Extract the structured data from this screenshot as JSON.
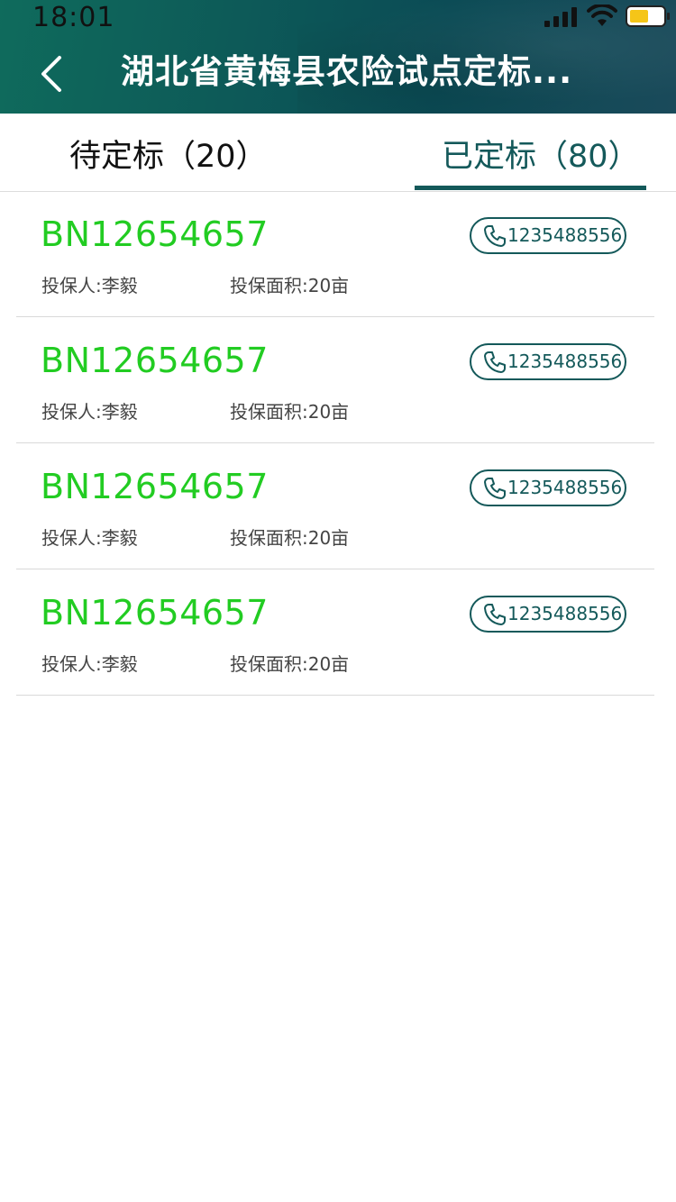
{
  "status_bar": {
    "time": "18:01"
  },
  "header": {
    "title": "湖北省黄梅县农险试点定标..."
  },
  "tabs": [
    {
      "label": "待定标（20）",
      "active": false
    },
    {
      "label": "已定标（80）",
      "active": true
    }
  ],
  "colors": {
    "accent": "#14595a",
    "policy_number": "#22cc22",
    "header_bg": "#0d5a58"
  },
  "records": [
    {
      "policy_no": "BN12654657",
      "phone": "1235488556",
      "insured": "投保人:李毅",
      "area": "投保面积:20亩"
    },
    {
      "policy_no": "BN12654657",
      "phone": "1235488556",
      "insured": "投保人:李毅",
      "area": "投保面积:20亩"
    },
    {
      "policy_no": "BN12654657",
      "phone": "1235488556",
      "insured": "投保人:李毅",
      "area": "投保面积:20亩"
    },
    {
      "policy_no": "BN12654657",
      "phone": "1235488556",
      "insured": "投保人:李毅",
      "area": "投保面积:20亩"
    }
  ],
  "icons": {
    "back": "chevron-left-icon",
    "phone": "phone-icon",
    "signal": "signal-icon",
    "wifi": "wifi-icon",
    "battery": "battery-icon"
  }
}
